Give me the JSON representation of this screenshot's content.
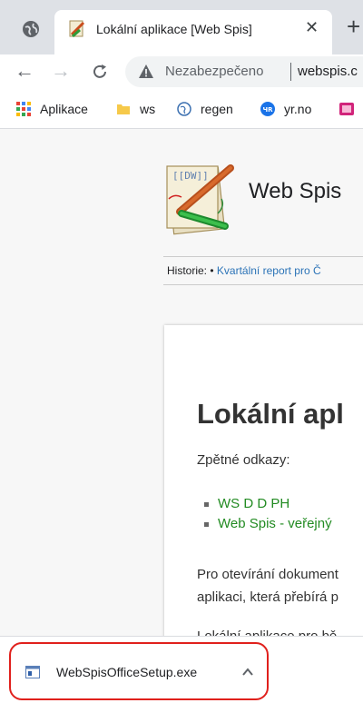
{
  "tab": {
    "title": "Lokální aplikace [Web Spis]",
    "close_icon": "close-icon"
  },
  "toolbar": {
    "security_status": "Nezabezpečeno",
    "url": "webspis.c"
  },
  "bookmarks": [
    {
      "label": "Aplikace",
      "icon": "apps-grid-icon"
    },
    {
      "label": "ws",
      "icon": "folder-icon"
    },
    {
      "label": "regen",
      "icon": "globe-icon"
    },
    {
      "label": "yr.no",
      "icon": "yr-icon",
      "badge": "ЧR"
    },
    {
      "label": "",
      "icon": "bookmark-favicon-icon"
    }
  ],
  "site": {
    "title": "Web Spis",
    "logo_text": "[[DW]]"
  },
  "breadcrumb": {
    "label": "Historie:",
    "separator": "•",
    "link": "Kvartální report pro Č"
  },
  "content": {
    "heading": "Lokální apl",
    "backlinks_label": "Zpětné odkazy:",
    "backlinks": [
      "WS D D PH",
      "Web Spis - veřejný"
    ],
    "paragraph_line1": "Pro otevírání dokument",
    "paragraph_line2": "aplikaci, která přebírá p",
    "paragraph2": "Lokální aplikace pro bě"
  },
  "download": {
    "filename": "WebSpisOfficeSetup.exe"
  },
  "colors": {
    "highlight": "#e0201c",
    "link_green": "#228b22",
    "link_blue": "#2b73b7"
  }
}
